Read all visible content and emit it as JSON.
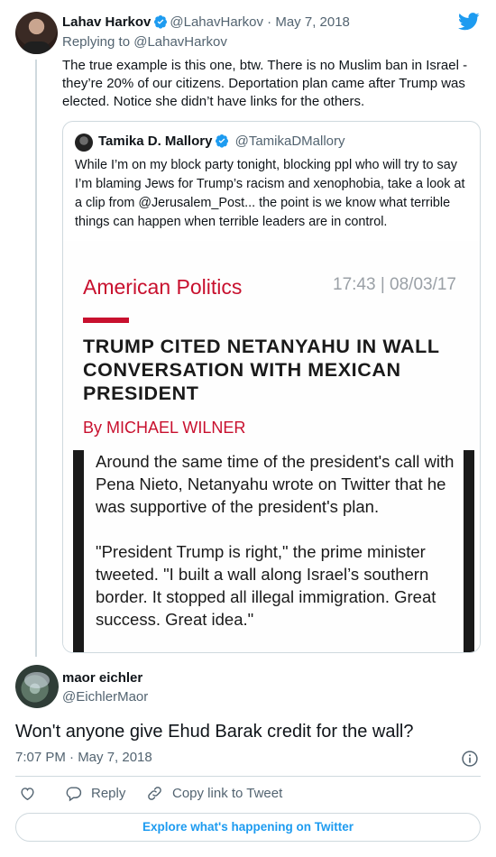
{
  "parent_tweet": {
    "author_name": "Lahav Harkov",
    "author_handle": "@LahavHarkov",
    "date": "May 7, 2018",
    "replying_to": "Replying to @LahavHarkov",
    "text": "The true example is this one, btw. There is no Muslim ban in Israel - they’re 20% of our citizens. Deportation plan came after Trump was elected. Notice she didn’t have links for the others."
  },
  "quoted_tweet": {
    "author_name": "Tamika D. Mallory",
    "author_handle": "@TamikaDMallory",
    "text": "While I’m on my block party tonight, blocking ppl who will try to say I’m blaming Jews for Trump’s racism and xenophobia, take a look at a clip from @Jerusalem_Post... the point is we know what terrible things can happen when terrible leaders are in control.",
    "image": {
      "section": "American Politics",
      "timestamp": "17:43 | 08/03/17",
      "headline": "TRUMP CITED NETANYAHU IN WALL CONVERSATION WITH MEXICAN PRESIDENT",
      "byline": "By MICHAEL WILNER",
      "paragraph1": "Around the same time of the president's call with Pena Nieto, Netanyahu wrote on Twitter that he was supportive of the president's plan.",
      "paragraph2": "\"President Trump is right,\" the prime minister tweeted. \"I built a wall along Israel’s southern border. It stopped all illegal immigration. Great success. Great idea.\""
    }
  },
  "reply_tweet": {
    "author_name": "maor eichler",
    "author_handle": "@EichlerMaor",
    "text": "Won't anyone give Ehud Barak credit for the wall?",
    "timestamp": "7:07 PM · May 7, 2018"
  },
  "actions": {
    "reply_label": "Reply",
    "copy_link_label": "Copy link to Tweet"
  },
  "explore_label": "Explore what's happening on Twitter",
  "colors": {
    "twitter_blue": "#1d9bf0",
    "jpost_red": "#c8102e",
    "muted_text": "#536471",
    "border": "#cfd9de"
  },
  "icons": [
    "verified-badge-icon",
    "twitter-bird-icon",
    "heart-icon",
    "reply-bubble-icon",
    "link-icon",
    "info-icon"
  ]
}
